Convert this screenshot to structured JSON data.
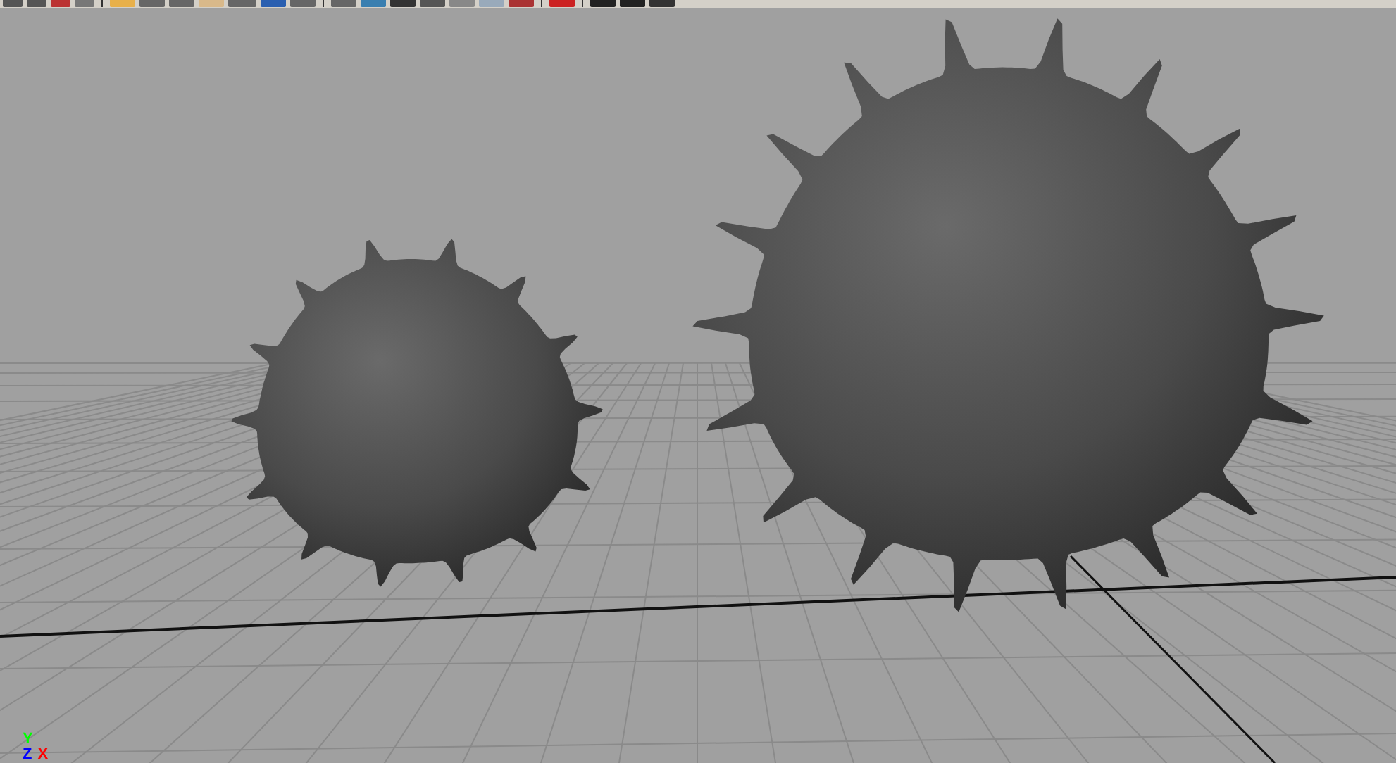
{
  "viewport": {
    "axis_labels": [
      {
        "label": "Y",
        "color": "#00ff00"
      },
      {
        "label": "Z",
        "color": "#0000ff"
      },
      {
        "label": "X",
        "color": "#ff0000"
      }
    ]
  }
}
